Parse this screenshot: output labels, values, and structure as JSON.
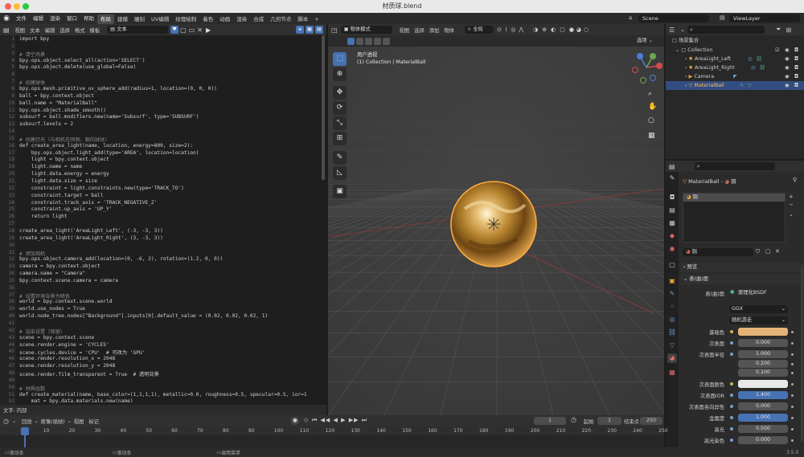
{
  "window": {
    "title": "材质球.blend"
  },
  "topbar": {
    "menus": [
      "文件",
      "编辑",
      "渲染",
      "窗口",
      "帮助"
    ],
    "workspaces": [
      "布局",
      "建模",
      "雕刻",
      "UV编辑",
      "纹理绘制",
      "着色",
      "动画",
      "渲染",
      "合成",
      "几何节点",
      "脚本"
    ],
    "active_workspace": "布局",
    "scene": "Scene",
    "view_layer": "ViewLayer"
  },
  "text_editor": {
    "menus": [
      "视图",
      "文本",
      "编辑",
      "选择",
      "格式",
      "模板"
    ],
    "datablock": "文本",
    "footer": "文字: 内部",
    "lines": [
      "import bpy",
      "",
      "# 清空场景",
      "bpy.ops.object.select_all(action='SELECT')",
      "bpy.ops.object.delete(use_global=False)",
      "",
      "# 创建球体",
      "bpy.ops.mesh.primitive_uv_sphere_add(radius=1, location=(0, 0, 0))",
      "ball = bpy.context.object",
      "ball.name = \"MaterialBall\"",
      "bpy.ops.object.shade_smooth()",
      "subsurf = ball.modifiers.new(name='Subsurf', type='SUBSURF')",
      "subsurf.levels = 2",
      "",
      "# 创建灯光（与相机在同侧，朝向球体）",
      "def create_area_light(name, location, energy=800, size=2):",
      "    bpy.ops.object.light_add(type='AREA', location=location)",
      "    light = bpy.context.object",
      "    light.name = name",
      "    light.data.energy = energy",
      "    light.data.size = size",
      "    constraint = light.constraints.new(type='TRACK_TO')",
      "    constraint.target = ball",
      "    constraint.track_axis = 'TRACK_NEGATIVE_Z'",
      "    constraint.up_axis = 'UP_Y'",
      "    return light",
      "",
      "create_area_light('AreaLight_Left', (-3, -3, 3))",
      "create_area_light('AreaLight_Right', (3, -3, 3))",
      "",
      "# 添加相机",
      "bpy.ops.object.camera_add(location=(0, -6, 2), rotation=(1.2, 0, 0))",
      "camera = bpy.context.object",
      "camera.name = \"Camera\"",
      "bpy.context.scene.camera = camera",
      "",
      "# 设置环境背景为暗色",
      "world = bpy.context.scene.world",
      "world.use_nodes = True",
      "world.node_tree.nodes[\"Background\"].inputs[0].default_value = (0.02, 0.02, 0.02, 1)",
      "",
      "# 渲染设置（保留）",
      "scene = bpy.context.scene",
      "scene.render.engine = 'CYCLES'",
      "scene.cycles.device = 'CPU'  # 可改为 'GPU'",
      "scene.render.resolution_x = 2048",
      "scene.render.resolution_y = 2048",
      "scene.render.film_transparent = True  # 透明背景",
      "",
      "# 材质函数",
      "def create_material(name, base_color=(1,1,1,1), metallic=0.0, roughness=0.5, specular=0.5, ior=1",
      "    mat = bpy.data.materials.new(name)",
      "    mat.use_nodes = True"
    ]
  },
  "viewport": {
    "mode": "物体模式",
    "menus": [
      "视图",
      "选择",
      "添加",
      "物体"
    ],
    "transform": "全局",
    "options": "选项",
    "view_name": "用户透视",
    "view_info": "(1) Collection | MaterialBall"
  },
  "outliner": {
    "root": "场景集合",
    "collection": "Collection",
    "items": [
      "AreaLight_Left",
      "AreaLight_Right",
      "Camera",
      "MaterialBall"
    ],
    "selected": "MaterialBall"
  },
  "properties": {
    "object": "MaterialBall",
    "material": "铜",
    "slot": "铜",
    "material_field": "铜",
    "sections": {
      "preview": "预览",
      "surface": "表(曲)面"
    },
    "surface_label": "表(曲)面",
    "shader": "原理化BSDF",
    "distribution": "GGX",
    "subsurface_method": "随机游走",
    "rows": [
      {
        "label": "基础色",
        "value": "",
        "type": "color",
        "color": "#e3b377"
      },
      {
        "label": "次表面",
        "value": "0.000",
        "type": "num"
      },
      {
        "label": "次表面半径",
        "value": "1.000",
        "type": "num"
      },
      {
        "label": "",
        "value": "0.200",
        "type": "num"
      },
      {
        "label": "",
        "value": "0.100",
        "type": "num"
      },
      {
        "label": "次表面颜色",
        "value": "",
        "type": "color",
        "color": "#e8e8e8"
      },
      {
        "label": "次表面IOR",
        "value": "1.400",
        "type": "blue"
      },
      {
        "label": "次表面各向异性",
        "value": "0.000",
        "type": "num"
      },
      {
        "label": "金属度",
        "value": "1.000",
        "type": "blue"
      },
      {
        "label": "高光",
        "value": "0.500",
        "type": "num"
      },
      {
        "label": "高光染色",
        "value": "0.000",
        "type": "num"
      }
    ]
  },
  "timeline": {
    "menus": [
      "回放",
      "抠像(插帧)",
      "视图",
      "标记"
    ],
    "current_frame": "1",
    "start_label": "起始",
    "start": "1",
    "end_label": "结束点",
    "end": "250",
    "ticks": [
      "1",
      "10",
      "20",
      "30",
      "40",
      "50",
      "60",
      "70",
      "80",
      "90",
      "100",
      "110",
      "120",
      "130",
      "140",
      "150",
      "160",
      "170",
      "180",
      "190",
      "200",
      "210",
      "220",
      "230",
      "240",
      "250"
    ]
  },
  "status": {
    "left": "滚动条",
    "mid": "滚动条",
    "right": "调用菜单",
    "version": "3.5.0"
  },
  "colors": {
    "accent": "#4772b3",
    "gold": "#d9a54a",
    "selection": "#ffaa40"
  }
}
